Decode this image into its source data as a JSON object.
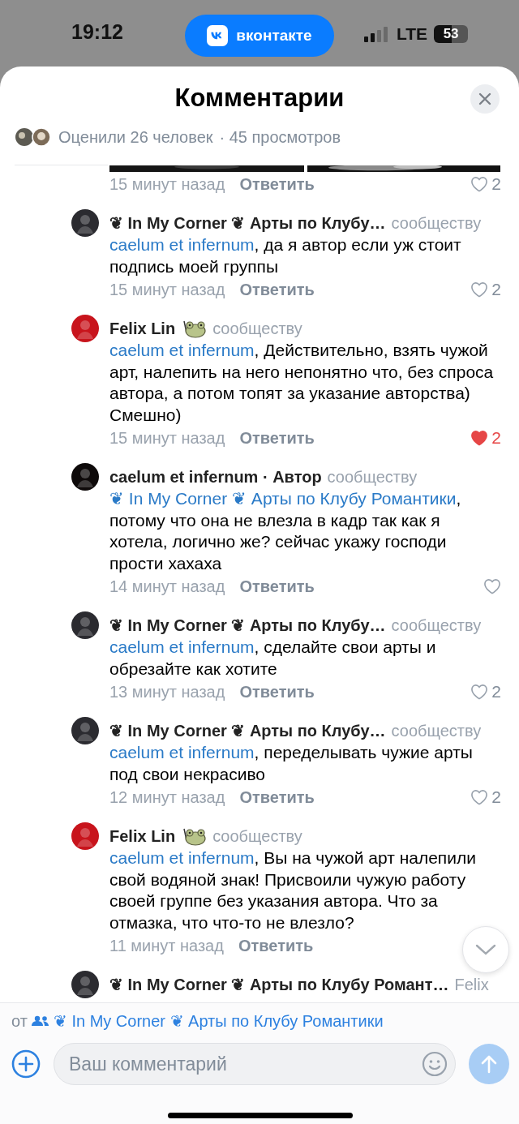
{
  "status_bar": {
    "time": "19:12",
    "app_pill": "вконтакте",
    "network": "LTE",
    "battery": "53"
  },
  "sheet": {
    "title": "Комментарии",
    "likes_summary": "Оценили 26 человек",
    "views": "· 45 просмотров"
  },
  "top_fragment": {
    "kind": "picture",
    "time": "15 минут назад",
    "reply": "Ответить",
    "likes": "2",
    "liked": false
  },
  "comments": [
    {
      "author": "❦ In My Corner ❦ Арты по Клубу…",
      "color": "#2b2b30",
      "sticker": false,
      "label": "сообществу",
      "mention": "caelum et infernum",
      "text": ", да я автор если уж стоит подпись моей группы",
      "time": "15 минут назад",
      "reply": "Ответить",
      "likes": "2",
      "liked": false
    },
    {
      "author": "Felix Lin",
      "color": "#c8141c",
      "sticker": true,
      "label": "сообществу",
      "mention": "caelum et infernum",
      "text": ", Действительно, взять чужой арт, налепить на него непонятно что, без спроса автора, а потом топят за указание авторства) Смешно)",
      "time": "15 минут назад",
      "reply": "Ответить",
      "likes": "2",
      "liked": true
    },
    {
      "author": "caelum et infernum · Автор",
      "color": "#0e0a0a",
      "sticker": false,
      "label": "сообществу",
      "mention": "❦ In My Corner ❦ Арты по Клубу Романтики",
      "text": ", потому что она не влезла в кадр так как я хотела, логично же? сейчас укажу господи прости хахаха",
      "time": "14 минут назад",
      "reply": "Ответить",
      "liked": false
    },
    {
      "author": "❦ In My Corner ❦ Арты по Клубу…",
      "color": "#2b2b30",
      "sticker": false,
      "label": "сообществу",
      "mention": "caelum et infernum",
      "text": ", сделайте свои арты и обрезайте как хотите",
      "time": "13 минут назад",
      "reply": "Ответить",
      "likes": "2",
      "liked": false
    },
    {
      "author": "❦ In My Corner ❦ Арты по Клубу…",
      "color": "#2b2b30",
      "sticker": false,
      "label": "сообществу",
      "mention": "caelum et infernum",
      "text": ", переделывать чужие арты под свои некрасиво",
      "time": "12 минут назад",
      "reply": "Ответить",
      "likes": "2",
      "liked": false
    },
    {
      "author": "Felix Lin",
      "color": "#c8141c",
      "sticker": true,
      "label": "сообществу",
      "mention": "caelum et infernum",
      "text": ", Вы на чужой арт налепили свой водяной знак! Присвоили чужую работу своей группе без указания автора. Что за отмазка, что что-то не влезло?",
      "time": "11 минут назад",
      "reply": "Ответить"
    },
    {
      "author": "❦ In My Corner ❦ Арты по Клубу Романт…",
      "color": "#2b2b30",
      "sticker": false,
      "label": "Felix"
    }
  ],
  "composer": {
    "from_label": "от",
    "from_group": "❦ In My Corner ❦ Арты по Клубу Романтики",
    "placeholder": "Ваш комментарий"
  }
}
